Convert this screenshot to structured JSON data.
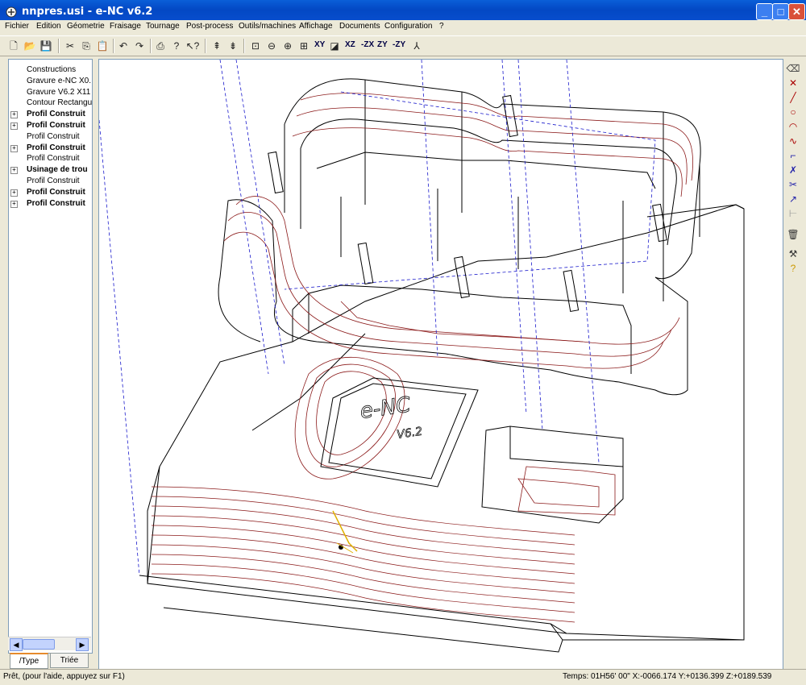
{
  "window": {
    "title": "nnpres.usi - e-NC v6.2",
    "minimize_label": "_",
    "maximize_label": "□",
    "close_label": "✕"
  },
  "menu": [
    "Fichier",
    "Edition",
    "Géometrie",
    "Fraisage",
    "Tournage",
    "Post-process",
    "Outils/machines",
    "Affichage",
    "Documents",
    "Configuration",
    "?"
  ],
  "toolbar": {
    "icons": [
      "new-file-icon",
      "open-folder-icon",
      "save-icon",
      "cut-icon",
      "copy-icon",
      "paste-icon",
      "undo-icon",
      "redo-icon",
      "print-icon",
      "help-icon",
      "context-help-icon",
      "move-up-icon",
      "move-down-icon",
      "zoom-window-icon",
      "zoom-out-icon",
      "zoom-in-icon",
      "zoom-all-icon"
    ],
    "views": [
      "XY",
      "XZ",
      "-ZX",
      "ZY",
      "-ZY"
    ]
  },
  "tree": [
    {
      "label": "Constructions",
      "bold": false,
      "expandable": false
    },
    {
      "label": "Gravure  e-NC X0.",
      "bold": false,
      "expandable": false
    },
    {
      "label": "Gravure  V6.2 X11",
      "bold": false,
      "expandable": false
    },
    {
      "label": "Contour Rectangul",
      "bold": false,
      "expandable": false
    },
    {
      "label": "Profil Construit",
      "bold": true,
      "expandable": true
    },
    {
      "label": "Profil Construit",
      "bold": true,
      "expandable": true
    },
    {
      "label": "Profil Construit",
      "bold": false,
      "expandable": false
    },
    {
      "label": "Profil Construit",
      "bold": true,
      "expandable": true
    },
    {
      "label": "Profil Construit",
      "bold": false,
      "expandable": false
    },
    {
      "label": "Usinage de trou",
      "bold": true,
      "expandable": true
    },
    {
      "label": "Profil Construit",
      "bold": false,
      "expandable": false
    },
    {
      "label": "Profil Construit",
      "bold": true,
      "expandable": true
    },
    {
      "label": "Profil Construit",
      "bold": true,
      "expandable": true
    }
  ],
  "tabs": {
    "type": "/Type",
    "sorted": "Triée"
  },
  "viewport": {
    "engraving_text": "e-NC",
    "engraving_subtext": "V6.2"
  },
  "right_toolbar": [
    "eraser-icon",
    "cross-icon",
    "line-icon",
    "circle-icon",
    "arc-icon",
    "spline-icon",
    "chamfer-icon",
    "trim-icon",
    "scissors-icon",
    "arrow-icon",
    "dimension-icon",
    "trash-icon",
    "tool-icon",
    "question-icon"
  ],
  "status": {
    "left": "Prêt, (pour l'aide, appuyez sur F1)",
    "right": "Temps: 01H56' 00\" X:-0066.174 Y:+0136.399 Z:+0189.539"
  },
  "colors": {
    "wire": "#000000",
    "toolpath": "#8b1a1a",
    "rapid": "#1a1acc",
    "tool": "#e0b000"
  }
}
